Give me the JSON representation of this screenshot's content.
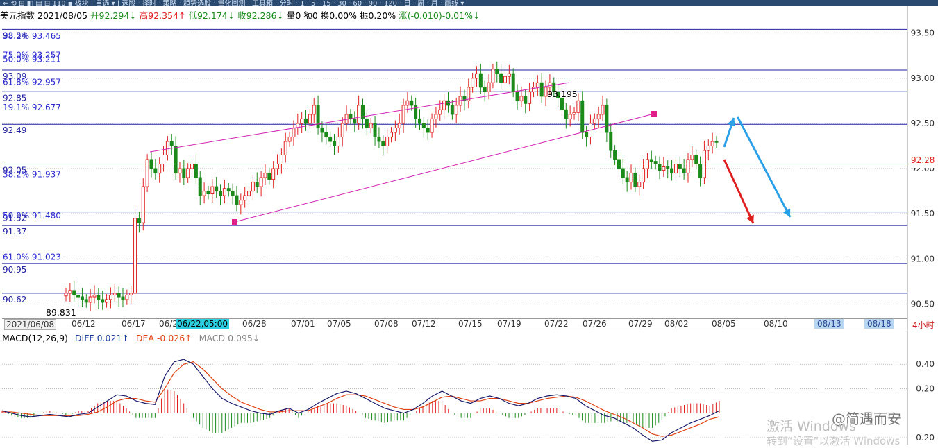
{
  "window": {
    "toolbar_text": "⇐ ⟲ ⊞ ◧ ▤ ⊟ 110 ▪ 板块 | 自选 ▾ | 选股 · 择时 · 策略 · 趋势选股 · 量化回测 · 工具箱 · 分时 · 1 · 5 · 15 · 30 · 60 · 90 · 120 · 日 · 周 · 月 · 画线 ▾"
  },
  "info": {
    "name": "美元指数",
    "date": "2021/08/05",
    "open_label": "开",
    "open": "92.294↓",
    "high_label": "高",
    "high": "92.354↑",
    "low_label": "低",
    "low": "92.174↓",
    "close_label": "收",
    "close": "92.286↓",
    "vol": "量0",
    "amount": "额0",
    "turnover": "换0.00%",
    "amplitude": "振0.20%",
    "change": "涨(-0.010)-0.01%↓"
  },
  "macd_info": {
    "title": "MACD(12,26,9)",
    "diff": "DIFF 0.021↑",
    "dea": "DEA -0.026↑",
    "macd": "MACD 0.095↓"
  },
  "period_label": "4小时",
  "current_price_label": "92.28",
  "watermark": {
    "line1": "激活 Windows",
    "line2": "转到“设置”以激活 Windows",
    "brand": "@简遇而安"
  },
  "colors": {
    "up": "#e02020",
    "down": "#1a8a1a",
    "level_line": "#2020a0",
    "channel": "#d020b0",
    "arrow_blue": "#2aa0e8",
    "arrow_red": "#e02020",
    "diff": "#1a1a6a",
    "dea": "#e04010"
  },
  "chart_data": [
    {
      "type": "candlestick",
      "title": "美元指数",
      "period": "4小时",
      "y_axis_ticks": [
        93.5,
        93.0,
        92.5,
        92.0,
        91.5,
        91.0,
        90.5
      ],
      "ylim": [
        90.35,
        93.62
      ],
      "x_tick_labels": [
        "2021/06/08",
        "06/12",
        "06/17",
        "06/2",
        "06/22,05:00",
        "06/28",
        "07/01",
        "07/05",
        "07/08",
        "07/12",
        "07/15",
        "07/19",
        "07/22",
        "07/26",
        "07/29",
        "08/02",
        "08/05",
        "08/10",
        "08/13",
        "08/18"
      ],
      "horizontal_levels": [
        {
          "label": "93.54",
          "value": 93.54
        },
        {
          "label": "93.09",
          "value": 93.09
        },
        {
          "label": "92.85",
          "value": 92.85
        },
        {
          "label": "92.49",
          "value": 92.49
        },
        {
          "label": "92.05",
          "value": 92.05
        },
        {
          "label": "91.52",
          "value": 91.52
        },
        {
          "label": "91.37",
          "value": 91.37
        },
        {
          "label": "90.95",
          "value": 90.95
        },
        {
          "label": "90.62",
          "value": 90.62
        }
      ],
      "fib_labels": [
        {
          "label": "38.2% 93.465",
          "value": 93.465
        },
        {
          "label": "75.0% 93.257",
          "value": 93.257
        },
        {
          "label": "50.0% 93.211",
          "value": 93.211
        },
        {
          "label": "61.8% 92.957",
          "value": 92.957
        },
        {
          "label": "19.1% 92.677",
          "value": 92.677
        },
        {
          "label": "38.2% 91.937",
          "value": 91.937
        },
        {
          "label": "50.0% 91.480",
          "value": 91.48
        },
        {
          "label": "61.0% 91.023",
          "value": 91.023
        }
      ],
      "annotations": [
        {
          "text": "93.195",
          "value": 93.195
        },
        {
          "text": "89.831",
          "value": 89.831
        }
      ],
      "current_price": 92.28,
      "closes": [
        90.62,
        90.65,
        90.6,
        90.58,
        90.55,
        90.52,
        90.58,
        90.6,
        90.55,
        90.52,
        90.55,
        90.6,
        90.62,
        90.58,
        90.55,
        90.6,
        90.62,
        91.45,
        91.4,
        91.8,
        92.1,
        92.0,
        91.95,
        92.05,
        92.15,
        92.3,
        92.25,
        91.95,
        92.0,
        91.9,
        92.0,
        92.05,
        91.9,
        91.7,
        91.75,
        91.72,
        91.8,
        91.75,
        91.7,
        91.78,
        91.75,
        91.7,
        91.6,
        91.65,
        91.7,
        91.75,
        91.85,
        91.8,
        91.9,
        91.95,
        91.88,
        92.0,
        92.05,
        92.15,
        92.3,
        92.35,
        92.45,
        92.5,
        92.55,
        92.5,
        92.6,
        92.7,
        92.45,
        92.4,
        92.35,
        92.3,
        92.25,
        92.35,
        92.5,
        92.6,
        92.55,
        92.5,
        92.7,
        92.55,
        92.45,
        92.5,
        92.35,
        92.3,
        92.25,
        92.35,
        92.4,
        92.45,
        92.5,
        92.7,
        92.75,
        92.7,
        92.55,
        92.5,
        92.45,
        92.4,
        92.55,
        92.6,
        92.65,
        92.75,
        92.7,
        92.6,
        92.7,
        92.8,
        92.75,
        92.9,
        93.0,
        93.05,
        92.9,
        92.85,
        92.95,
        93.1,
        93.05,
        92.95,
        93.02,
        93.05,
        92.85,
        92.75,
        92.8,
        92.72,
        92.85,
        92.9,
        92.95,
        92.8,
        92.9,
        92.95,
        92.85,
        92.78,
        92.65,
        92.55,
        92.6,
        92.62,
        92.75,
        92.4,
        92.35,
        92.5,
        92.55,
        92.6,
        92.7,
        92.4,
        92.2,
        92.1,
        92.0,
        91.9,
        91.85,
        91.95,
        91.8,
        91.85,
        92.0,
        92.1,
        92.08,
        92.05,
        91.98,
        92.02,
        92.0,
        91.95,
        92.05,
        92.0,
        91.95,
        92.1,
        92.15,
        92.05,
        91.9,
        92.2,
        92.25,
        92.3,
        92.29
      ]
    },
    {
      "type": "line+bar",
      "title": "MACD(12,26,9)",
      "series": [
        {
          "name": "DIFF",
          "values": [
            0.02,
            0.0,
            -0.02,
            -0.03,
            -0.02,
            -0.01,
            -0.02,
            -0.03,
            -0.01,
            0.0,
            0.05,
            0.1,
            0.15,
            0.14,
            0.1,
            0.08,
            0.07,
            0.3,
            0.42,
            0.44,
            0.4,
            0.3,
            0.2,
            0.12,
            0.08,
            0.05,
            0.02,
            0.0,
            -0.01,
            0.02,
            0.04,
            0.0,
            0.03,
            0.08,
            0.12,
            0.16,
            0.18,
            0.16,
            0.12,
            0.08,
            0.04,
            0.02,
            0.0,
            0.03,
            0.08,
            0.14,
            0.18,
            0.14,
            0.1,
            0.08,
            0.12,
            0.14,
            0.12,
            0.08,
            0.06,
            0.08,
            0.12,
            0.14,
            0.15,
            0.14,
            0.12,
            0.06,
            0.02,
            -0.02,
            -0.04,
            -0.08,
            -0.12,
            -0.18,
            -0.23,
            -0.22,
            -0.16,
            -0.12,
            -0.08,
            -0.05,
            -0.02,
            0.02
          ]
        },
        {
          "name": "DEA",
          "values": [
            0.01,
            0.01,
            0.0,
            -0.01,
            -0.02,
            -0.02,
            -0.02,
            -0.02,
            -0.02,
            -0.01,
            0.01,
            0.05,
            0.1,
            0.12,
            0.12,
            0.1,
            0.09,
            0.2,
            0.33,
            0.4,
            0.42,
            0.36,
            0.28,
            0.2,
            0.14,
            0.09,
            0.06,
            0.03,
            0.01,
            0.01,
            0.02,
            0.02,
            0.02,
            0.05,
            0.08,
            0.12,
            0.15,
            0.15,
            0.14,
            0.11,
            0.08,
            0.05,
            0.03,
            0.03,
            0.05,
            0.09,
            0.13,
            0.14,
            0.12,
            0.1,
            0.1,
            0.12,
            0.12,
            0.1,
            0.08,
            0.08,
            0.1,
            0.12,
            0.13,
            0.14,
            0.13,
            0.1,
            0.06,
            0.02,
            -0.01,
            -0.04,
            -0.08,
            -0.12,
            -0.17,
            -0.19,
            -0.18,
            -0.15,
            -0.12,
            -0.09,
            -0.05,
            -0.03
          ]
        }
      ],
      "y_axis_ticks": [
        0.4,
        0.2,
        -0.2
      ],
      "ylim": [
        -0.24,
        0.56
      ]
    }
  ]
}
